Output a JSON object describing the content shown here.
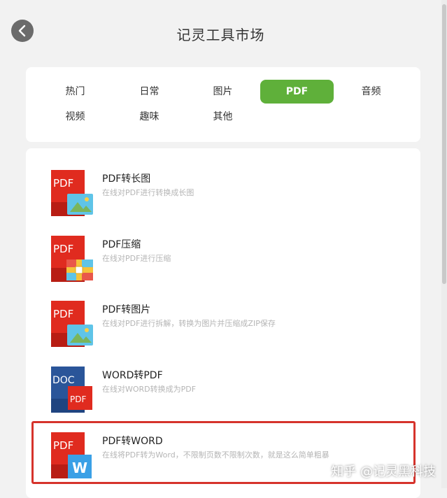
{
  "header": {
    "title": "记灵工具市场"
  },
  "tabs": [
    {
      "label": "热门",
      "active": false
    },
    {
      "label": "日常",
      "active": false
    },
    {
      "label": "图片",
      "active": false
    },
    {
      "label": "PDF",
      "active": true
    },
    {
      "label": "音频",
      "active": false
    },
    {
      "label": "视频",
      "active": false
    },
    {
      "label": "趣味",
      "active": false
    },
    {
      "label": "其他",
      "active": false
    }
  ],
  "tools": [
    {
      "title": "PDF转长图",
      "desc": "在线对PDF进行转换成长图",
      "icon": "pdf-to-image-icon",
      "doc_label": "PDF"
    },
    {
      "title": "PDF压缩",
      "desc": "在线对PDF进行压缩",
      "icon": "pdf-compress-icon",
      "doc_label": "PDF"
    },
    {
      "title": "PDF转图片",
      "desc": "在线对PDF进行拆解，转换为图片并压缩成ZIP保存",
      "icon": "pdf-to-image-icon",
      "doc_label": "PDF"
    },
    {
      "title": "WORD转PDF",
      "desc": "在线对WORD转换成为PDF",
      "icon": "word-to-pdf-icon",
      "doc_label": "DOC",
      "badge_label": "PDF"
    },
    {
      "title": "PDF转WORD",
      "desc": "在线将PDF转为Word，不限制页数不限制次数，就是这么简单粗暴",
      "icon": "pdf-to-word-icon",
      "doc_label": "PDF",
      "badge_label": "W"
    }
  ],
  "watermark": "知乎 @记灵黑科技",
  "colors": {
    "accent": "#5fb03a",
    "pdf_red": "#e02b1f",
    "word_blue": "#2a5599",
    "highlight": "#d6332c"
  }
}
